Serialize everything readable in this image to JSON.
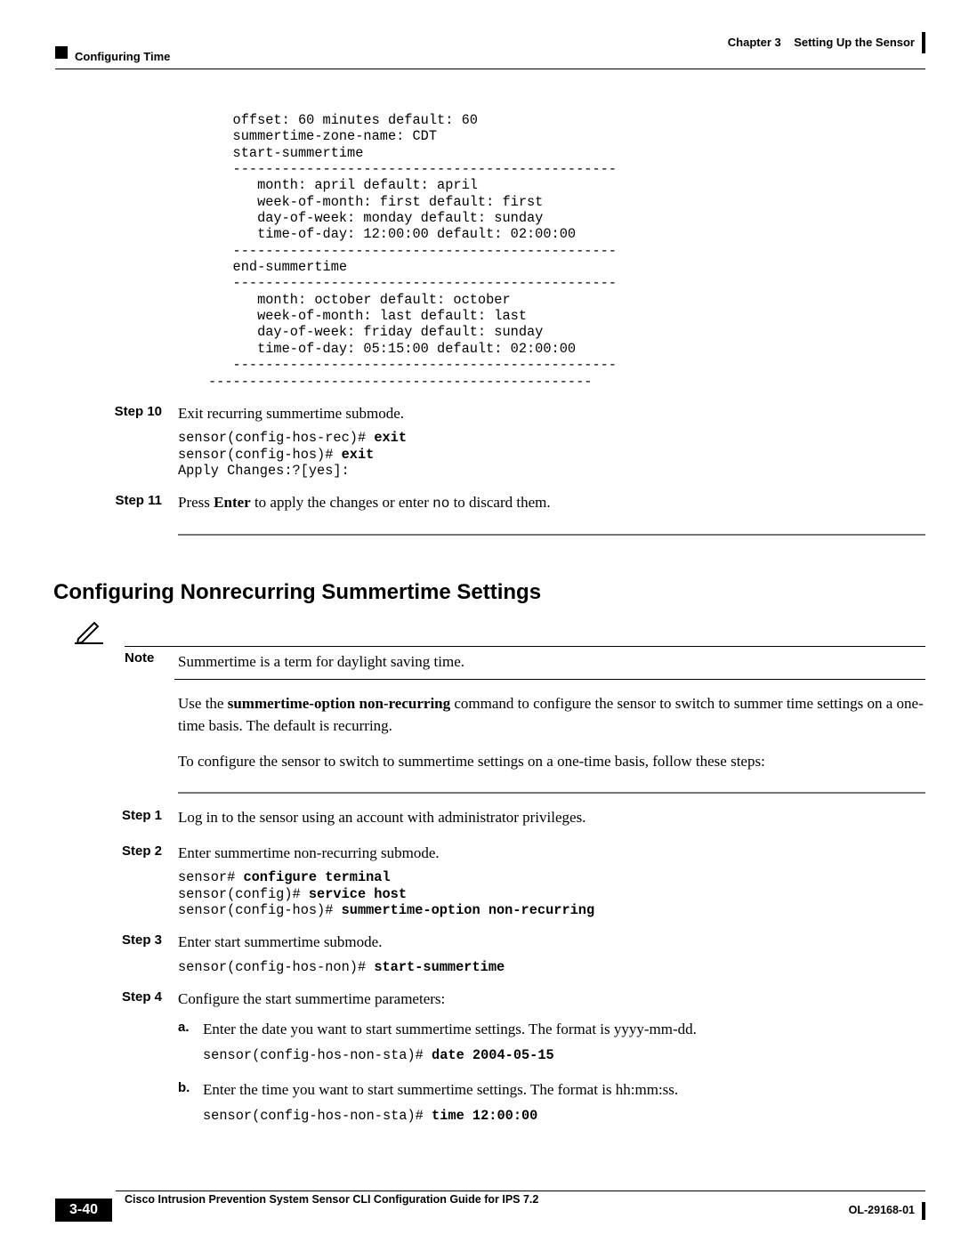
{
  "header": {
    "chapter_ref": "Chapter 3",
    "chapter_title": "Setting Up the Sensor",
    "section": "Configuring Time"
  },
  "code_top_lines": [
    "   offset: 60 minutes default: 60",
    "   summertime-zone-name: CDT",
    "   start-summertime",
    "   -----------------------------------------------",
    "      month: april default: april",
    "      week-of-month: first default: first",
    "      day-of-week: monday default: sunday",
    "      time-of-day: 12:00:00 default: 02:00:00",
    "   -----------------------------------------------",
    "   end-summertime",
    "   -----------------------------------------------",
    "      month: october default: october",
    "      week-of-month: last default: last",
    "      day-of-week: friday default: sunday",
    "      time-of-day: 05:15:00 default: 02:00:00",
    "   -----------------------------------------------",
    "-----------------------------------------------"
  ],
  "step10": {
    "label": "Step 10",
    "text": "Exit recurring summertime submode.",
    "code": [
      {
        "pre": "sensor(config-hos-rec)# ",
        "bold": "exit"
      },
      {
        "pre": "sensor(config-hos)# ",
        "bold": "exit"
      },
      {
        "pre": "Apply Changes:?[yes]:",
        "bold": ""
      }
    ]
  },
  "step11": {
    "label": "Step 11",
    "prefix": "Press ",
    "bold1": "Enter",
    "mid": " to apply the changes or enter ",
    "mono": "no",
    "suffix": " to discard them."
  },
  "h2": "Configuring Nonrecurring Summertime Settings",
  "note": {
    "label": "Note",
    "text": "Summertime is a term for daylight saving time."
  },
  "para1_pre": "Use the ",
  "para1_bold": "summertime-option non-recurring",
  "para1_post": " command to configure the sensor to switch to summer time settings on a one-time basis. The default is recurring.",
  "para2": "To configure the sensor to switch to summertime settings on a one-time basis, follow these steps:",
  "step1": {
    "label": "Step 1",
    "text": "Log in to the sensor using an account with administrator privileges."
  },
  "step2": {
    "label": "Step 2",
    "text": "Enter summertime non-recurring submode.",
    "code": [
      {
        "pre": "sensor# ",
        "bold": "configure terminal"
      },
      {
        "pre": "sensor(config)# ",
        "bold": "service host"
      },
      {
        "pre": "sensor(config-hos)# ",
        "bold": "summertime-option non-recurring"
      }
    ]
  },
  "step3": {
    "label": "Step 3",
    "text": "Enter start summertime submode.",
    "code": [
      {
        "pre": "sensor(config-hos-non)# ",
        "bold": "start-summertime"
      }
    ]
  },
  "step4": {
    "label": "Step 4",
    "text": "Configure the start summertime parameters:",
    "sub_a": {
      "lbl": "a.",
      "text": "Enter the date you want to start summertime settings. The format is yyyy-mm-dd.",
      "code_pre": "sensor(config-hos-non-sta)# ",
      "code_bold": "date 2004-05-15"
    },
    "sub_b": {
      "lbl": "b.",
      "text": "Enter the time you want to start summertime settings. The format is hh:mm:ss.",
      "code_pre": "sensor(config-hos-non-sta)# ",
      "code_bold": "time 12:00:00"
    }
  },
  "footer": {
    "guide": "Cisco Intrusion Prevention System Sensor CLI Configuration Guide for IPS 7.2",
    "page": "3-40",
    "doc": "OL-29168-01"
  }
}
